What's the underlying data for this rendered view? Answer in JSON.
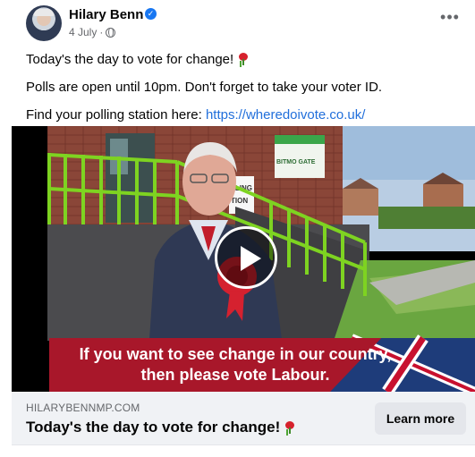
{
  "post": {
    "author": "Hilary Benn",
    "date": "4 July",
    "dot": "·",
    "more_label": "•••",
    "lines": [
      "Today's the day to vote for change!",
      "Polls are open until 10pm. Don't forget to take your voter ID.",
      "Find your polling station here:"
    ],
    "link": "https://wheredoivote.co.uk/"
  },
  "video": {
    "sign_text": "LLING TION",
    "building_sign": "BITMO GATE",
    "caption_line1": "If you want to see change in our country,",
    "caption_line2": "then please vote Labour."
  },
  "preview": {
    "domain": "HILARYBENNMP.COM",
    "title": "Today's the day to vote for change!",
    "button": "Learn more"
  },
  "icons": {
    "verified": "verified-badge-icon",
    "globe": "globe-icon",
    "rose": "rose-emoji-icon",
    "play": "play-icon",
    "more": "more-options-icon"
  },
  "colors": {
    "link": "#216fdb",
    "verified": "#1877f2",
    "caption_bar": "#a8172a",
    "railing": "#7ed321"
  }
}
